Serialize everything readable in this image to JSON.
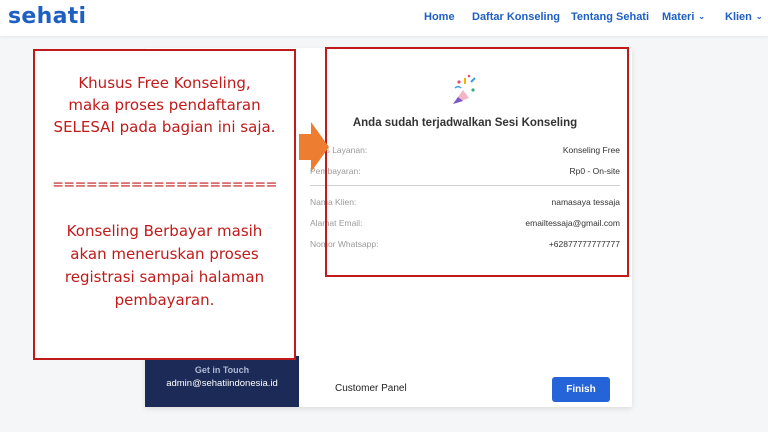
{
  "brand": {
    "logo": "sehati",
    "colors": {
      "primary": "#1e5fc2",
      "annotation": "#c01a1a",
      "arrow": "#ec7d31",
      "contact_bg": "#1b2a57"
    }
  },
  "nav": {
    "items": [
      {
        "label": "Home"
      },
      {
        "label": "Daftar Konseling"
      },
      {
        "label": "Tentang Sehati"
      },
      {
        "label": "Materi",
        "dropdown": true
      },
      {
        "label": "Klien",
        "dropdown": true
      }
    ]
  },
  "confirmation": {
    "icon": "party-popper-icon",
    "title": "Anda sudah terjadwalkan Sesi Konseling",
    "rows": [
      {
        "label": "Jenis Layanan:",
        "value": "Konseling Free"
      },
      {
        "label": "Pembayaran:",
        "value": "Rp0 - On-site"
      },
      {
        "label": "Nama Klien:",
        "value": "namasaya tessaja"
      },
      {
        "label": "Alamat Email:",
        "value": "emailtessaja@gmail.com"
      },
      {
        "label": "Nomor Whatsapp:",
        "value": "+62877777777777"
      }
    ]
  },
  "contact": {
    "title": "Get in Touch",
    "email": "admin@sehatiindonesia.id"
  },
  "footer": {
    "panel_label": "Customer Panel",
    "finish_label": "Finish"
  },
  "annotation": {
    "lines_top": [
      "Khusus Free Konseling,",
      "maka proses pendaftaran",
      "SELESAI pada bagian ini saja."
    ],
    "separator": "====================",
    "lines_bottom": [
      "Konseling Berbayar masih",
      "akan meneruskan proses",
      "registrasi sampai halaman",
      "pembayaran."
    ]
  }
}
